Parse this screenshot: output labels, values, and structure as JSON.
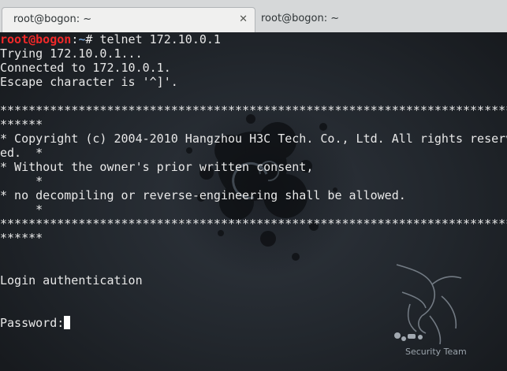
{
  "tabs": [
    {
      "label": "root@bogon: ~",
      "active": true,
      "close_glyph": "✕"
    },
    {
      "label": "root@bogon: ~",
      "active": false
    }
  ],
  "terminal": {
    "prompt_user": "root@bogon",
    "prompt_sep": ":",
    "prompt_path": "~",
    "prompt_symbol": "# ",
    "command": "telnet 172.10.0.1",
    "lines": [
      "Trying 172.10.0.1...",
      "Connected to 172.10.0.1.",
      "Escape character is '^]'.",
      "",
      "********************************************************************************",
      "******",
      "* Copyright (c) 2004-2010 Hangzhou H3C Tech. Co., Ltd. All rights reserv",
      "ed.  *",
      "* Without the owner's prior written consent,",
      "     *",
      "* no decompiling or reverse-engineering shall be allowed.",
      "     *",
      "********************************************************************************",
      "******",
      "",
      "",
      "Login authentication",
      "",
      ""
    ],
    "password_prompt": "Password:"
  },
  "wallpaper": {
    "caption": "Security Team",
    "icon": "kali-dragon-icon"
  },
  "colors": {
    "prompt_user": "#ef2929",
    "prompt_path": "#729fcf",
    "text": "#e8e8e8"
  }
}
